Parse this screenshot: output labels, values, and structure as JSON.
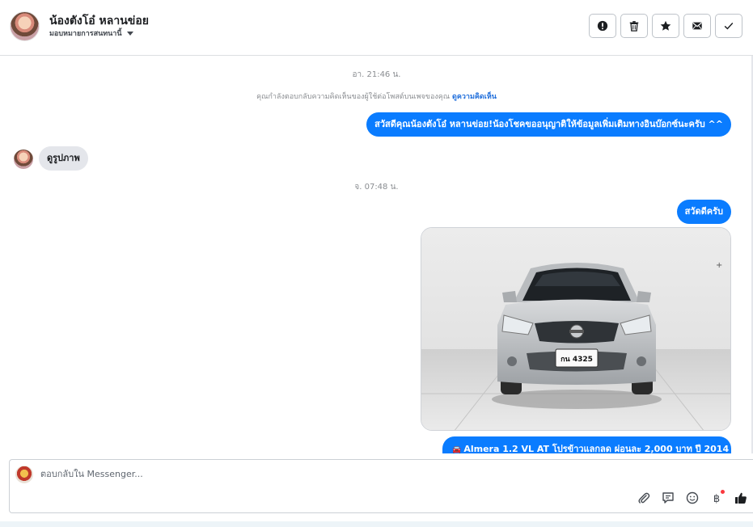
{
  "header": {
    "contact_name": "น้องตังโอ๋ หลานข่อย",
    "assign_label": "มอบหมายการสนทนานี้",
    "actions": [
      {
        "name": "mark-spam-button",
        "icon": "exclamation-circle-icon"
      },
      {
        "name": "delete-button",
        "icon": "trash-icon"
      },
      {
        "name": "star-button",
        "icon": "star-icon"
      },
      {
        "name": "mark-unread-button",
        "icon": "envelope-icon"
      },
      {
        "name": "mark-done-button",
        "icon": "check-icon"
      }
    ]
  },
  "thread": {
    "time_1": "อา. 21:46 น.",
    "notice_text": "คุณกำลังตอบกลับความคิดเห็นของผู้ใช้ต่อโพสต์บนเพจของคุณ",
    "notice_link": "ดูความคิดเห็น",
    "msg_out_1": "สวัสดีคุณน้องตังโอ๋ หลานข่อย!น้องโชคขออนุญาติให้ข้อมูลเพิ่มเติมทางอินบ๊อกซ์นะครับ ^^",
    "msg_in_1": "ดูรูปภาพ",
    "time_2": "จ. 07:48 น.",
    "msg_out_2": "สวัดดีครับ",
    "photo_plate": "กน 4325",
    "msg_out_3": "Almera 1.2 VL AT โปรข้าวแลกลด ผ่อนละ 2,000 บาท ปี 2014"
  },
  "composer": {
    "placeholder": "ตอบกลับใน Messenger...",
    "tools": [
      "paperclip-icon",
      "saved-reply-icon",
      "emoji-icon",
      "baht-icon",
      "thumbs-up-icon"
    ]
  },
  "colors": {
    "accent": "#0a7cff",
    "bubble_in": "#e4e6eb",
    "link": "#216fdb"
  }
}
